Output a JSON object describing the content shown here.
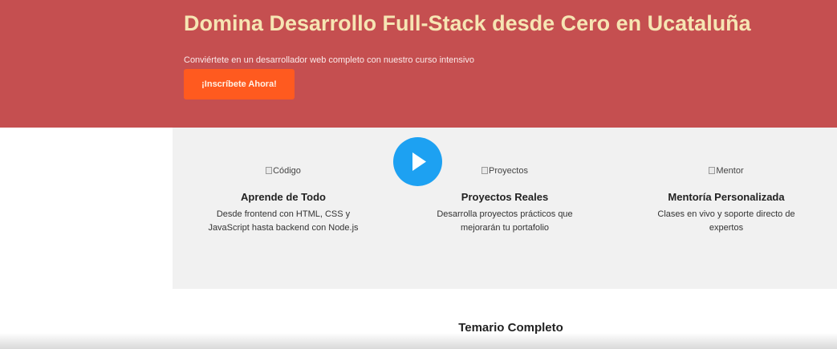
{
  "hero": {
    "title": "Domina Desarrollo Full-Stack desde Cero en Ucataluña",
    "subtitle": "Conviértete en un desarrollador web completo con nuestro curso intensivo",
    "cta_label": "¡Inscríbete Ahora!"
  },
  "features": [
    {
      "image_alt": "Código",
      "title": "Aprende de Todo",
      "description": "Desde frontend con HTML, CSS y JavaScript hasta backend con Node.js"
    },
    {
      "image_alt": "Proyectos",
      "title": "Proyectos Reales",
      "description": "Desarrolla proyectos prácticos que mejorarán tu portafolio"
    },
    {
      "image_alt": "Mentor",
      "title": "Mentoría Personalizada",
      "description": "Clases en vivo y soporte directo de expertos"
    }
  ],
  "video": {
    "icon": "play-icon"
  },
  "syllabus": {
    "title": "Temario Completo"
  },
  "colors": {
    "hero_bg": "#c54f50",
    "hero_title": "#f6e5b3",
    "cta_bg": "#ff5a1f",
    "features_bg": "#f1f1f1",
    "play_button": "#1da1f2"
  }
}
